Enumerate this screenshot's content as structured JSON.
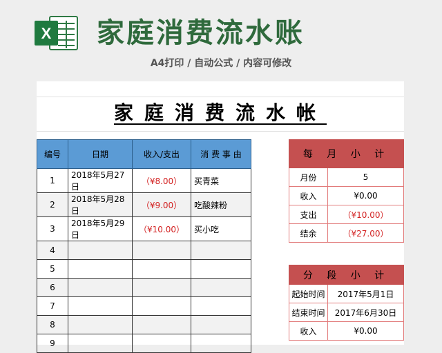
{
  "banner": {
    "title": "家庭消费流水账",
    "subtitle": "A4打印 / 自动公式 / 内容可修改",
    "logo_icon": "excel-icon",
    "brand_color": "#2f6a3c"
  },
  "sheet": {
    "title": "家庭消费流水帐",
    "columns": [
      "编号",
      "日期",
      "收入/支出",
      "消 费 事 由"
    ],
    "rows": [
      {
        "no": "1",
        "date": "2018年5月27日",
        "amount": "（¥8.00）",
        "reason": "买青菜"
      },
      {
        "no": "2",
        "date": "2018年5月28日",
        "amount": "（¥9.00）",
        "reason": "吃酸辣粉"
      },
      {
        "no": "3",
        "date": "2018年5月29日",
        "amount": "（¥10.00）",
        "reason": "买小吃"
      },
      {
        "no": "4",
        "date": "",
        "amount": "",
        "reason": ""
      },
      {
        "no": "5",
        "date": "",
        "amount": "",
        "reason": ""
      },
      {
        "no": "6",
        "date": "",
        "amount": "",
        "reason": ""
      },
      {
        "no": "7",
        "date": "",
        "amount": "",
        "reason": ""
      },
      {
        "no": "8",
        "date": "",
        "amount": "",
        "reason": ""
      },
      {
        "no": "9",
        "date": "",
        "amount": "",
        "reason": ""
      }
    ],
    "monthly": {
      "header": "每 月 小 计",
      "rows": [
        {
          "label": "月份",
          "value": "5",
          "red": false
        },
        {
          "label": "收入",
          "value": "¥0.00",
          "red": false
        },
        {
          "label": "支出",
          "value": "（¥10.00）",
          "red": true
        },
        {
          "label": "结余",
          "value": "（¥27.00）",
          "red": true
        }
      ]
    },
    "segment": {
      "header": "分 段 小 计",
      "rows": [
        {
          "label": "起始时间",
          "value": "2017年5月1日",
          "red": false
        },
        {
          "label": "结束时间",
          "value": "2017年6月30日",
          "red": false
        },
        {
          "label": "收入",
          "value": "¥0.00",
          "red": false
        }
      ]
    },
    "colors": {
      "header_blue": "#5b9bd5",
      "header_red": "#c55050",
      "negative_red": "#d21e1e"
    }
  }
}
